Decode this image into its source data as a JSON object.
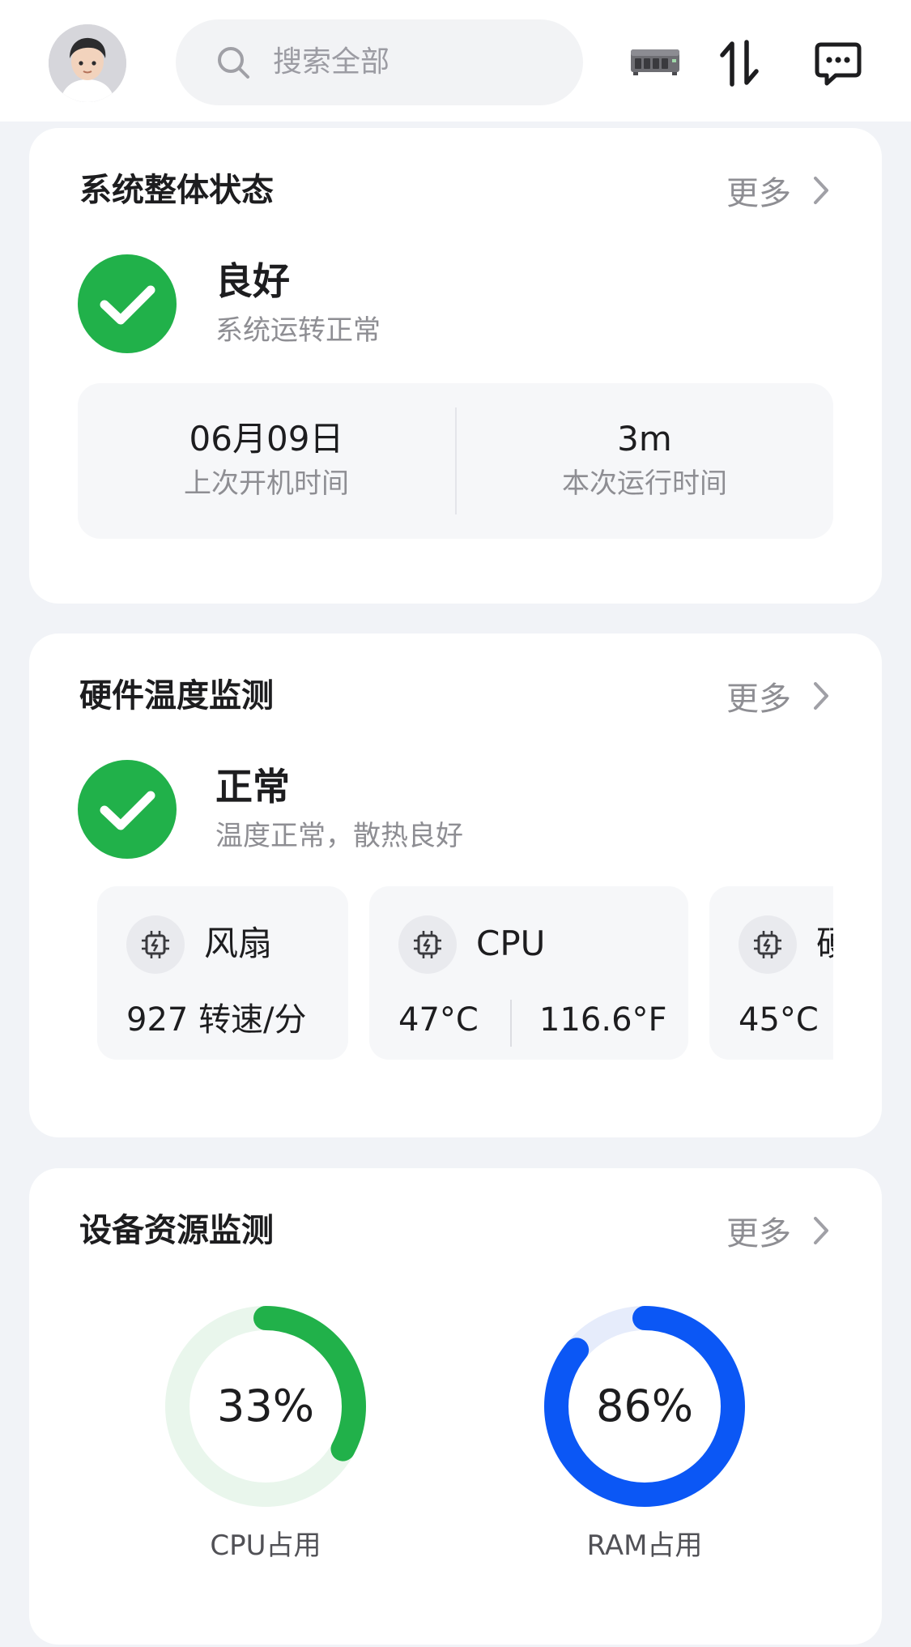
{
  "header": {
    "search_placeholder": "搜索全部",
    "icons": [
      "avatar",
      "search-icon",
      "nas-device-icon",
      "transfer-icon",
      "message-icon"
    ]
  },
  "system_status": {
    "title": "系统整体状态",
    "more": "更多",
    "status": "良好",
    "status_desc": "系统运转正常",
    "last_boot_value": "06月09日",
    "last_boot_label": "上次开机时间",
    "uptime_value": "3m",
    "uptime_label": "本次运行时间"
  },
  "hardware_temp": {
    "title": "硬件温度监测",
    "more": "更多",
    "status": "正常",
    "status_desc": "温度正常，散热良好",
    "sensors": [
      {
        "name": "风扇",
        "value": "927 转速/分"
      },
      {
        "name": "CPU",
        "celsius": "47°C",
        "fahrenheit": "116.6°F"
      },
      {
        "name": "硬",
        "celsius": "45°C"
      }
    ]
  },
  "resource_monitor": {
    "title": "设备资源监测",
    "more": "更多",
    "cpu": {
      "value": "33%",
      "fraction": 0.33,
      "label": "CPU占用",
      "color": "#21b14a",
      "track": "#e9f6ec"
    },
    "ram": {
      "value": "86%",
      "fraction": 0.86,
      "label": "RAM占用",
      "color": "#0b57f5",
      "track": "#e6ecfb"
    }
  },
  "colors": {
    "ok_green": "#21b14a",
    "background": "#f1f3f7"
  }
}
